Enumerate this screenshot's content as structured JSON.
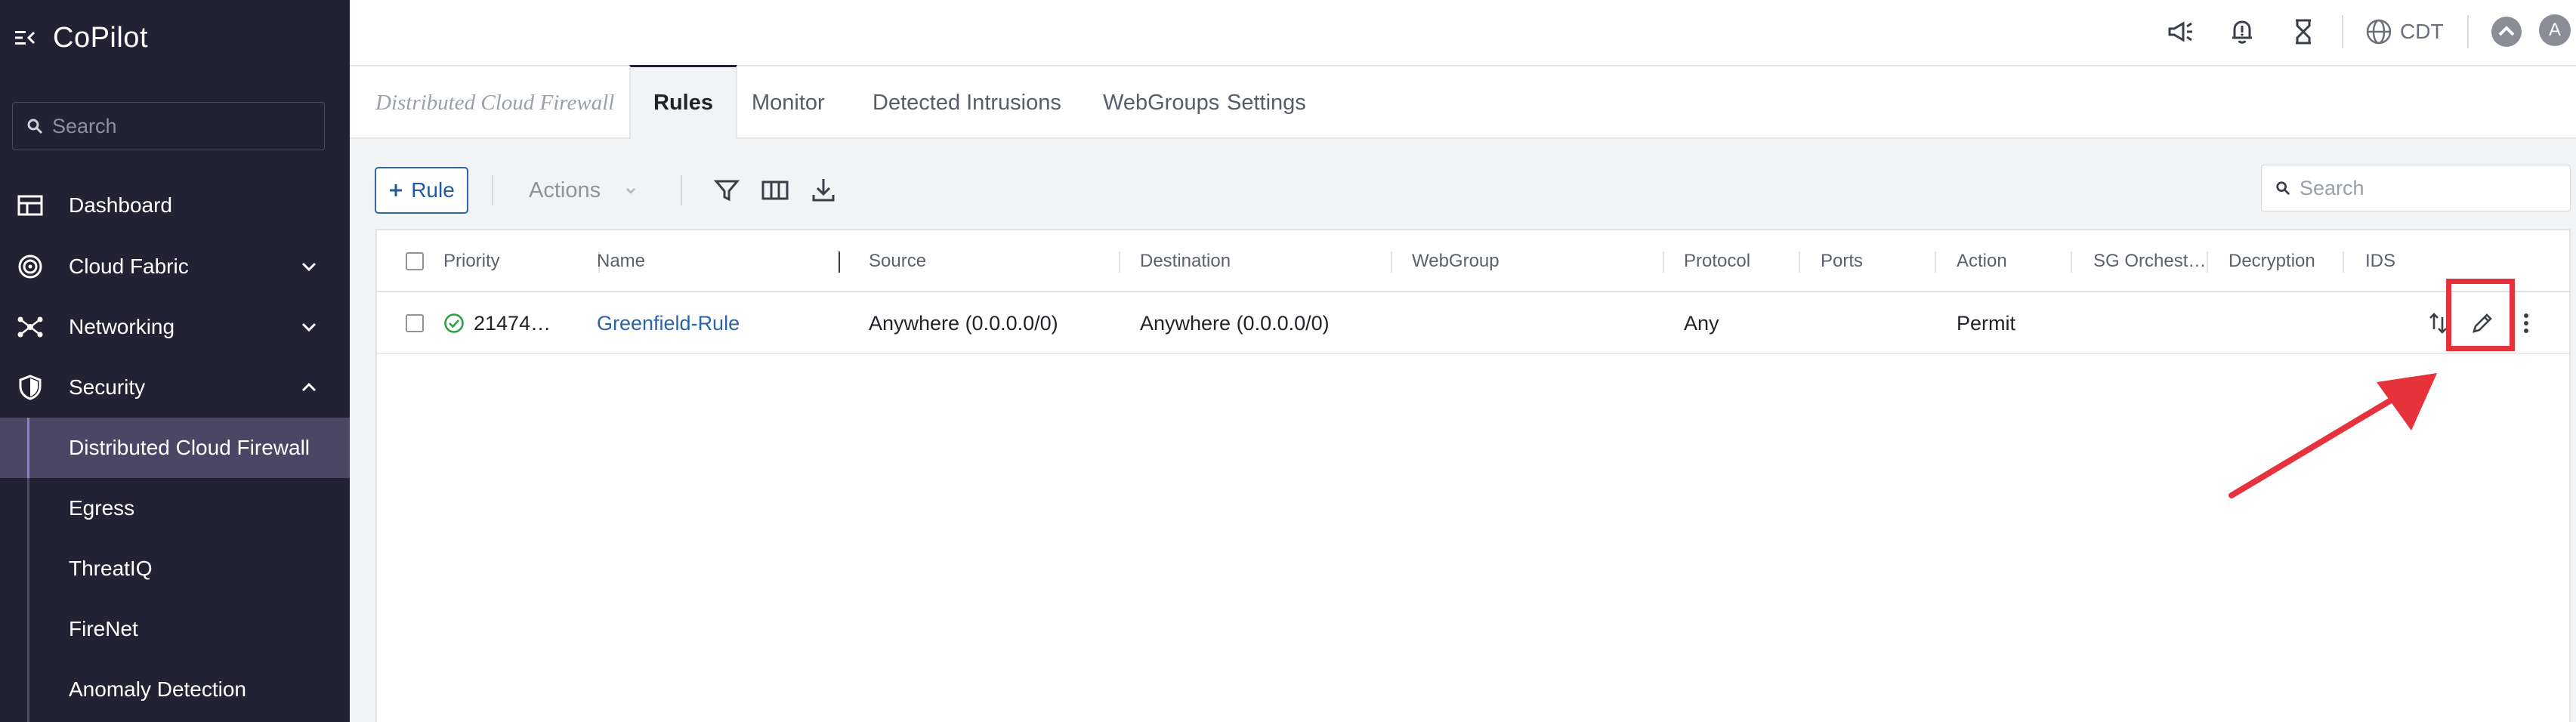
{
  "app": {
    "title": "CoPilot"
  },
  "sidebar": {
    "search_placeholder": "Search",
    "items": [
      {
        "label": "Dashboard",
        "icon": "dashboard-icon"
      },
      {
        "label": "Cloud Fabric",
        "icon": "cloud-fabric-icon",
        "expanded": false
      },
      {
        "label": "Networking",
        "icon": "networking-icon",
        "expanded": false
      },
      {
        "label": "Security",
        "icon": "shield-icon",
        "expanded": true
      }
    ],
    "security_subitems": [
      {
        "label": "Distributed Cloud Firewall",
        "active": true
      },
      {
        "label": "Egress"
      },
      {
        "label": "ThreatIQ"
      },
      {
        "label": "FireNet"
      },
      {
        "label": "Anomaly Detection"
      }
    ]
  },
  "topbar": {
    "icons": [
      "announcement-icon",
      "notification-bell-icon",
      "hourglass-icon",
      "globe-icon"
    ],
    "timezone": "CDT",
    "avatar_letter": "A"
  },
  "tabs": {
    "breadcrumb": "Distributed Cloud Firewall",
    "items": [
      "Rules",
      "Monitor",
      "Detected Intrusions",
      "WebGroups",
      "Settings"
    ],
    "active": "Rules"
  },
  "toolbar": {
    "add_rule_label": "Rule",
    "actions_label": "Actions",
    "search_placeholder": "Search"
  },
  "grid": {
    "columns": [
      "Priority",
      "Name",
      "Source",
      "Destination",
      "WebGroup",
      "Protocol",
      "Ports",
      "Action",
      "SG Orchest…",
      "Decryption",
      "IDS"
    ],
    "rows": [
      {
        "priority": "21474…",
        "status": "ok",
        "name": "Greenfield-Rule",
        "source": "Anywhere (0.0.0.0/0)",
        "destination": "Anywhere (0.0.0.0/0)",
        "webgroup": "",
        "protocol": "Any",
        "ports": "",
        "action": "Permit",
        "sg_orchestration": "",
        "decryption": "",
        "ids": ""
      }
    ]
  },
  "colors": {
    "sidebar_bg": "#232235",
    "active_item_bg": "#4a4663",
    "accent": "#2f66a8",
    "highlight": "#e5323b",
    "status_ok": "#2f9e44"
  }
}
